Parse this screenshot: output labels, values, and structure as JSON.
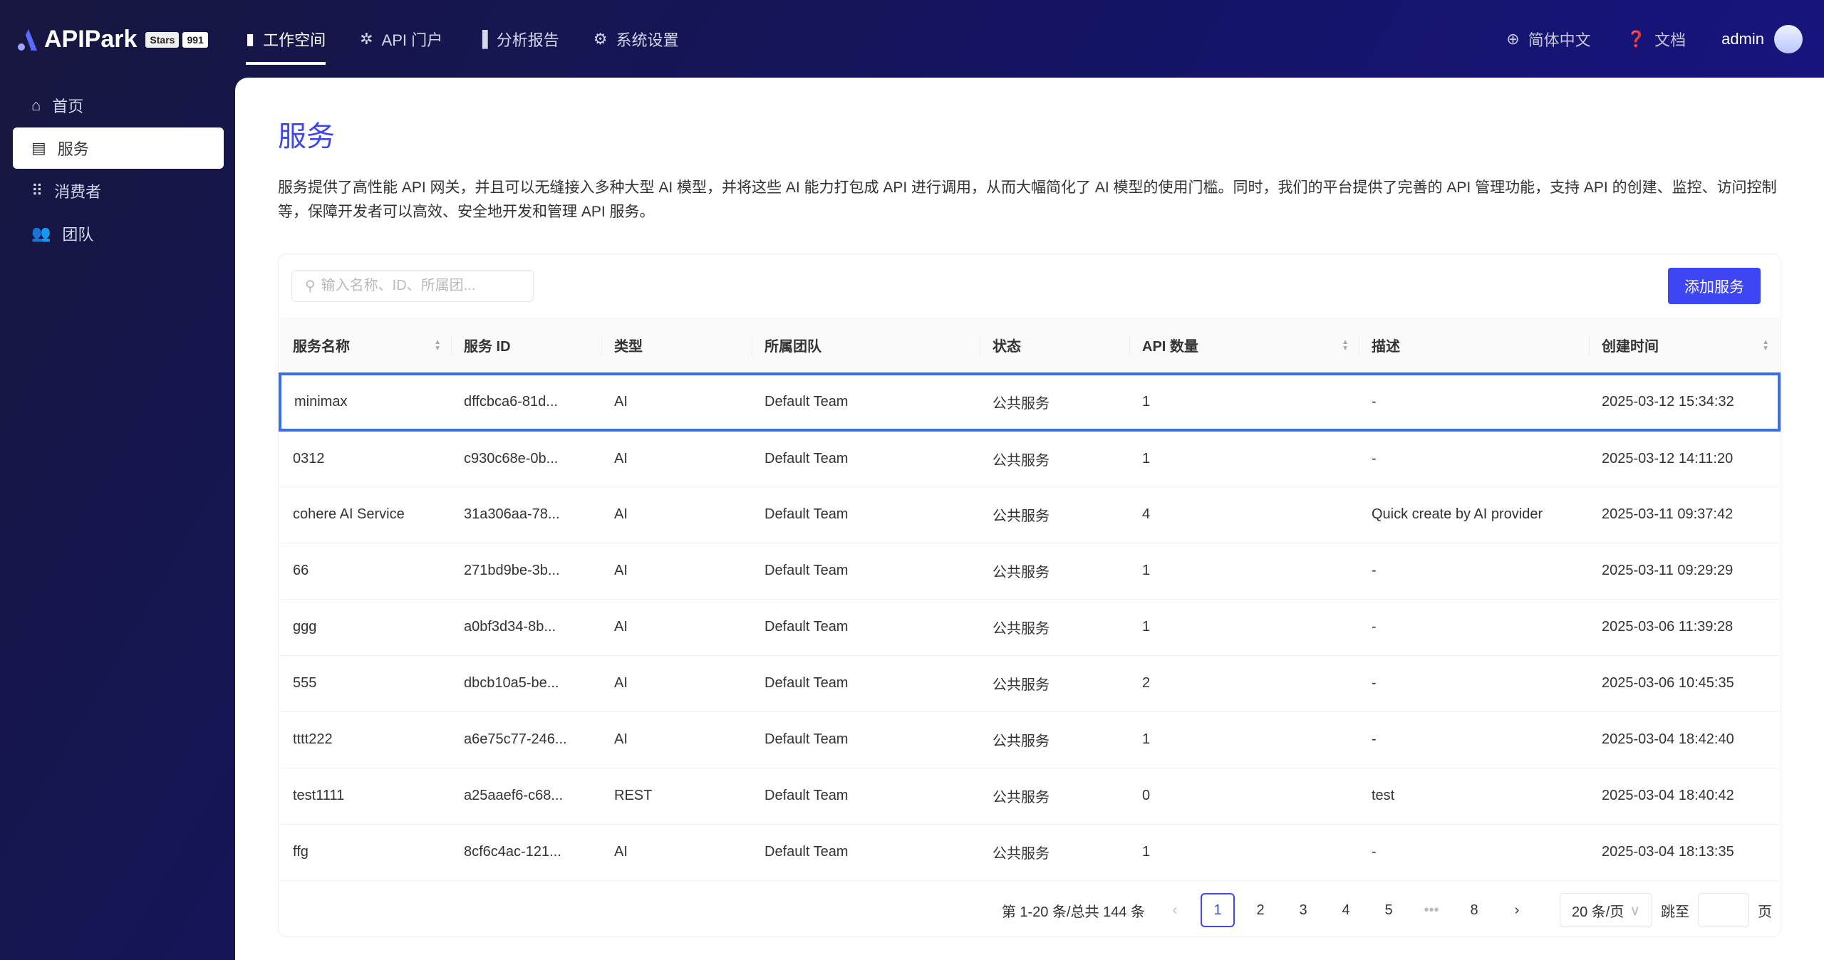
{
  "header": {
    "logo": "APIPark",
    "stars_label": "Stars",
    "stars_count": "991",
    "nav": [
      {
        "label": "工作空间",
        "icon": "workspace-icon"
      },
      {
        "label": "API 门户",
        "icon": "portal-icon"
      },
      {
        "label": "分析报告",
        "icon": "chart-icon"
      },
      {
        "label": "系统设置",
        "icon": "gear-icon"
      }
    ],
    "language": "简体中文",
    "docs": "文档",
    "user": "admin"
  },
  "sidebar": {
    "items": [
      {
        "label": "首页",
        "icon": "home-icon"
      },
      {
        "label": "服务",
        "icon": "service-icon",
        "active": true
      },
      {
        "label": "消费者",
        "icon": "grid-icon"
      },
      {
        "label": "团队",
        "icon": "team-icon"
      }
    ]
  },
  "main": {
    "title": "服务",
    "description": "服务提供了高性能 API 网关，并且可以无缝接入多种大型 AI 模型，并将这些 AI 能力打包成 API 进行调用，从而大幅简化了 AI 模型的使用门槛。同时，我们的平台提供了完善的 API 管理功能，支持 API 的创建、监控、访问控制等，保障开发者可以高效、安全地开发和管理 API 服务。",
    "search_placeholder": "输入名称、ID、所属团...",
    "add_button": "添加服务",
    "columns": [
      "服务名称",
      "服务 ID",
      "类型",
      "所属团队",
      "状态",
      "API 数量",
      "描述",
      "创建时间"
    ],
    "rows": [
      [
        "minimax",
        "dffcbca6-81d...",
        "AI",
        "Default Team",
        "公共服务",
        "1",
        "-",
        "2025-03-12 15:34:32"
      ],
      [
        "0312",
        "c930c68e-0b...",
        "AI",
        "Default Team",
        "公共服务",
        "1",
        "-",
        "2025-03-12 14:11:20"
      ],
      [
        "cohere AI Service",
        "31a306aa-78...",
        "AI",
        "Default Team",
        "公共服务",
        "4",
        "Quick create by AI provider",
        "2025-03-11 09:37:42"
      ],
      [
        "66",
        "271bd9be-3b...",
        "AI",
        "Default Team",
        "公共服务",
        "1",
        "-",
        "2025-03-11 09:29:29"
      ],
      [
        "ggg",
        "a0bf3d34-8b...",
        "AI",
        "Default Team",
        "公共服务",
        "1",
        "-",
        "2025-03-06 11:39:28"
      ],
      [
        "555",
        "dbcb10a5-be...",
        "AI",
        "Default Team",
        "公共服务",
        "2",
        "-",
        "2025-03-06 10:45:35"
      ],
      [
        "tttt222",
        "a6e75c77-246...",
        "AI",
        "Default Team",
        "公共服务",
        "1",
        "-",
        "2025-03-04 18:42:40"
      ],
      [
        "test1111",
        "a25aaef6-c68...",
        "REST",
        "Default Team",
        "公共服务",
        "0",
        "test",
        "2025-03-04 18:40:42"
      ],
      [
        "ffg",
        "8cf6c4ac-121...",
        "AI",
        "Default Team",
        "公共服务",
        "1",
        "-",
        "2025-03-04 18:13:35"
      ]
    ],
    "pagination": {
      "summary": "第 1-20 条/总共 144 条",
      "pages": [
        "1",
        "2",
        "3",
        "4",
        "5",
        "•••",
        "8"
      ],
      "current": "1",
      "page_size": "20 条/页",
      "jump_label": "跳至",
      "page_suffix": "页"
    }
  },
  "colors": {
    "accent": "#3d46f2",
    "selected_row_border": "#3a6ef0",
    "header_bg": "#17173f"
  }
}
